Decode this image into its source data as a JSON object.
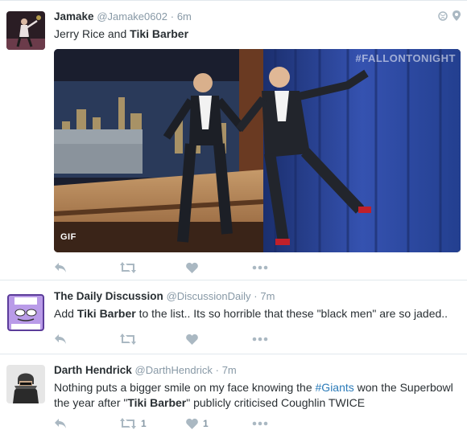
{
  "tweets": [
    {
      "name": "Jamake",
      "handle": "@Jamake0602",
      "time": "6m",
      "text_parts": [
        "Jerry Rice and ",
        "Tiki Barber",
        ""
      ],
      "media": {
        "watermark": "#FALLONTONIGHT",
        "badge": "GIF"
      },
      "actions": {
        "retweets": "",
        "likes": ""
      }
    },
    {
      "name": "The Daily Discussion",
      "handle": "@DiscussionDaily",
      "time": "7m",
      "text_parts": [
        "Add ",
        "Tiki Barber",
        " to the list.. Its so horrible that these \"black men\" are so jaded.."
      ],
      "actions": {
        "retweets": "",
        "likes": ""
      }
    },
    {
      "name": "Darth Hendrick",
      "handle": "@DarthHendrick",
      "time": "7m",
      "text_a": "Nothing puts a bigger smile on my face knowing the ",
      "hashtag": "#Giants",
      "text_b": " won the Superbowl the year after \"",
      "bold": "Tiki Barber",
      "text_c": "\" publicly criticised Coughlin TWICE",
      "actions": {
        "retweets": "1",
        "likes": "1"
      }
    }
  ],
  "icons": {
    "reply": "reply-icon",
    "retweet": "retweet-icon",
    "like": "heart-icon",
    "more": "more-dots-icon",
    "globe": "globe-icon",
    "location": "location-pin-icon"
  },
  "colors": {
    "text": "#292f33",
    "meta": "#8899a6",
    "hashtag": "#2b7bb9",
    "action_icon": "#aab8c2",
    "divider": "#e1e8ed"
  }
}
